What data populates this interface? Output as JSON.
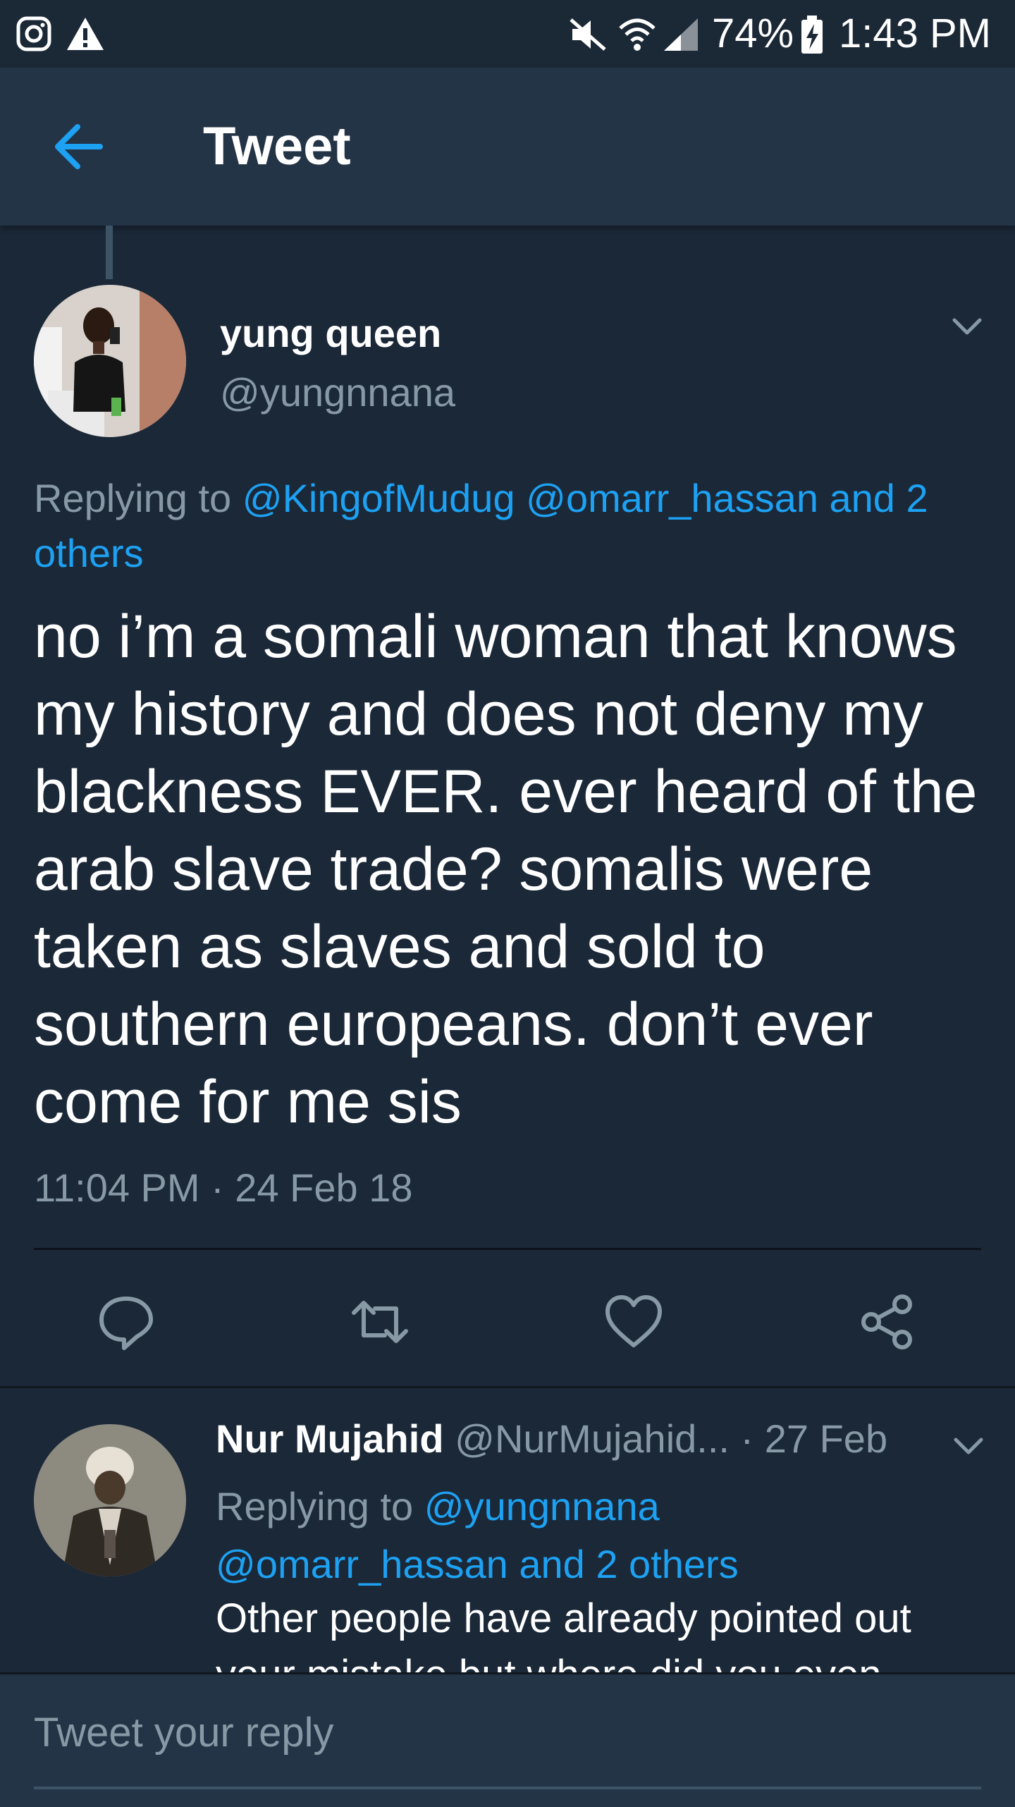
{
  "status_bar": {
    "battery": "74%",
    "time": "1:43 PM"
  },
  "header": {
    "title": "Tweet"
  },
  "main_tweet": {
    "author_name": "yung queen",
    "author_handle": "@yungnnana",
    "replying_prefix": "Replying to ",
    "replying_link": "@KingofMudug @omarr_hassan and 2 others",
    "text": "no i’m a somali woman that knows my history and does not deny my blackness EVER. ever heard of the arab slave trade? somalis were taken as slaves and sold to southern europeans. don’t ever come for me sis",
    "timestamp": "11:04 PM · 24 Feb 18"
  },
  "reply_tweet": {
    "author_name": "Nur Mujahid",
    "author_handle": "@NurMujahid...",
    "separator": "·",
    "date": "27 Feb",
    "replying_prefix": "Replying to ",
    "replying_link": "@yungnnana @omarr_hassan and 2 others",
    "text": "Other people have already pointed out your mistake but where did you even"
  },
  "reply_bar": {
    "placeholder": "Tweet your reply"
  },
  "colors": {
    "background": "#1b2838",
    "header": "#243447",
    "accent": "#1da1f2",
    "secondary_text": "#8899a6"
  },
  "icons": [
    "instagram-icon",
    "warning-icon",
    "mute-icon",
    "wifi-icon",
    "signal-icon",
    "battery-charging-icon",
    "back-arrow-icon",
    "chevron-down-icon",
    "reply-icon",
    "retweet-icon",
    "like-icon",
    "share-icon"
  ]
}
